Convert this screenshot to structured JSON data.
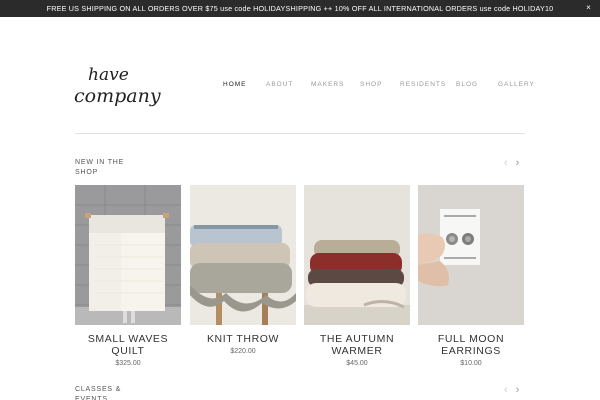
{
  "banner": {
    "text": "FREE US SHIPPING ON ALL ORDERS OVER $75 use code HOLIDAYSHIPPING ++ 10% OFF ALL INTERNATIONAL ORDERS use code HOLIDAY10",
    "close": "×"
  },
  "logo": {
    "line1": "have",
    "line2": "company"
  },
  "nav": {
    "items": [
      "HOME",
      "ABOUT",
      "MAKERS",
      "SHOP",
      "RESIDENTS",
      "BLOG",
      "GALLERY"
    ]
  },
  "sections": {
    "new_in_shop": {
      "title": "NEW IN THE SHOP",
      "prev": "‹",
      "next": "›"
    },
    "classes_events": {
      "title": "CLASSES & EVENTS",
      "prev": "‹",
      "next": "›"
    }
  },
  "products": [
    {
      "name": "SMALL WAVES QUILT",
      "price": "$325.00"
    },
    {
      "name": "KNIT THROW",
      "price": "$220.00"
    },
    {
      "name": "THE AUTUMN WARMER",
      "price": "$45.00"
    },
    {
      "name": "FULL MOON EARRINGS",
      "price": "$10.00"
    }
  ],
  "colors": {
    "banner_bg": "#2b2b2b",
    "text": "#333333",
    "nav_muted": "#999999"
  }
}
